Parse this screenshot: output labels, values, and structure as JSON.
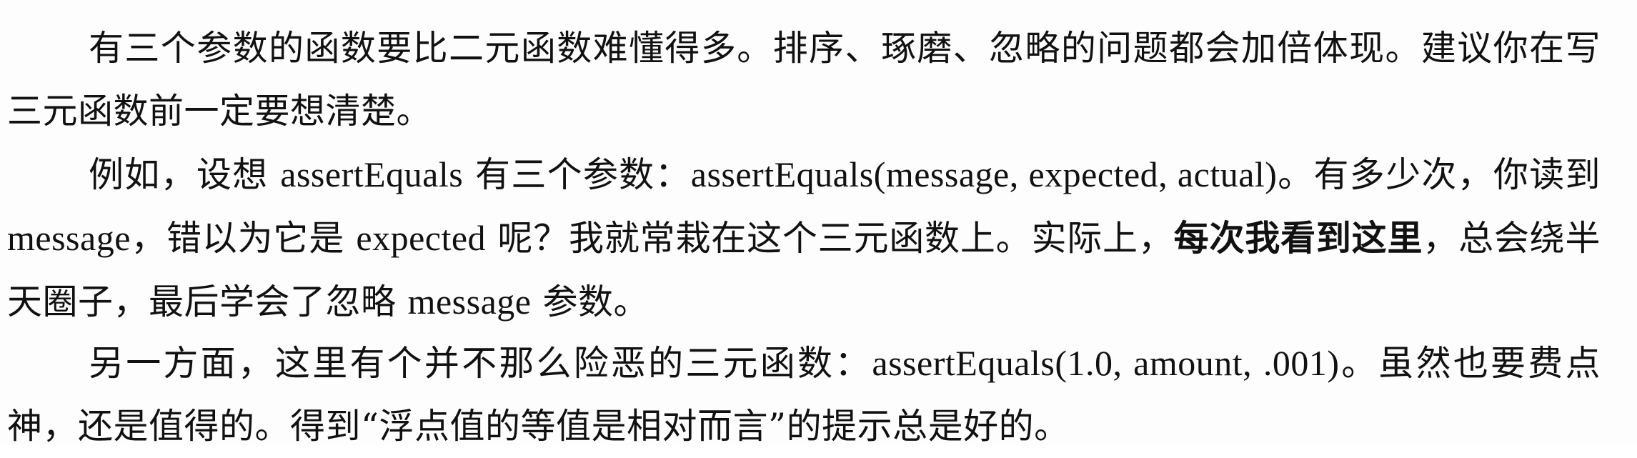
{
  "paragraphs": [
    {
      "id": "p1",
      "text": "有三个参数的函数要比二元函数难懂得多。排序、琢磨、忽略的问题都会加倍体现。建议你在写三元函数前一定要想清楚。"
    },
    {
      "id": "p2",
      "segments": [
        "例如，设想 ",
        "assertEquals",
        " 有三个参数：",
        "assertEquals(message, expected, actual)",
        "。有多少次，你读到 ",
        "message",
        "，错以为它是 ",
        "expected",
        " 呢？我就常栽在这个三元函数上。实际上，",
        "每次我看到这里",
        "，总会绕半天圈子，最后学会了忽略 ",
        "message",
        " 参数。"
      ]
    },
    {
      "id": "p3",
      "segments": [
        "另一方面，这里有个并不那么险恶的三元函数：",
        "assertEquals(1.0, amount, .001)",
        "。虽然也要费点神，还是值得的。得到“浮点值的等值是相对而言”的提示总是好的。"
      ]
    }
  ]
}
